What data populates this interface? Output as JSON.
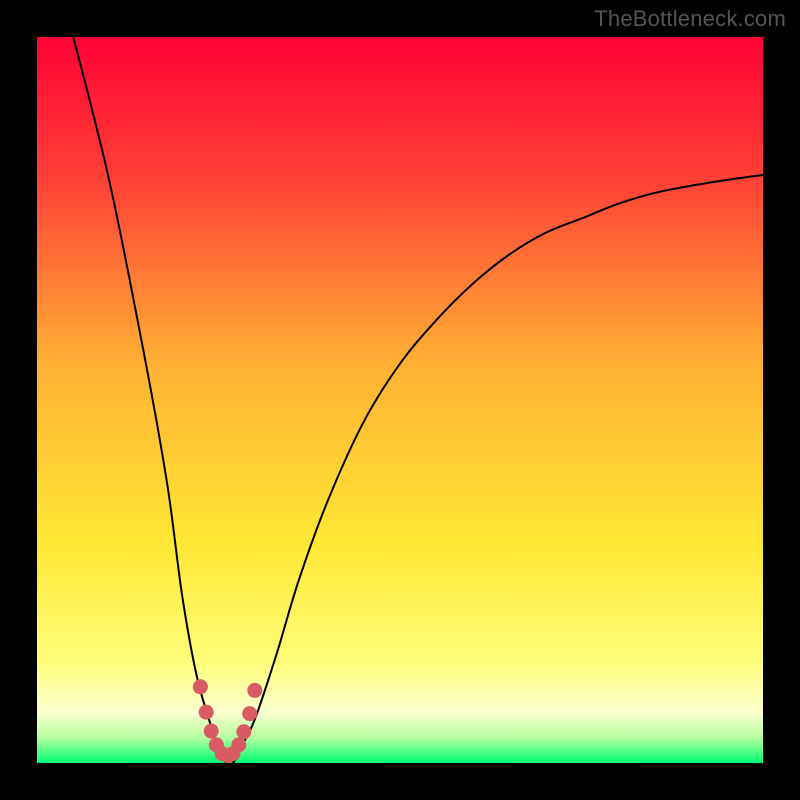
{
  "watermark": "TheBottleneck.com",
  "colors": {
    "frame": "#000000",
    "curve": "#000000",
    "highlight": "#d85a62",
    "watermark_text": "#555555",
    "gradient_stops": [
      {
        "offset": 0.0,
        "color": "#ff0135"
      },
      {
        "offset": 0.2,
        "color": "#ff4236"
      },
      {
        "offset": 0.45,
        "color": "#ffb033"
      },
      {
        "offset": 0.7,
        "color": "#ffe834"
      },
      {
        "offset": 0.86,
        "color": "#fffd7a"
      },
      {
        "offset": 0.93,
        "color": "#fbffce"
      },
      {
        "offset": 0.965,
        "color": "#b6ffa0"
      },
      {
        "offset": 1.0,
        "color": "#00ff73"
      }
    ]
  },
  "chart_data": {
    "type": "line",
    "title": "",
    "xlabel": "",
    "ylabel": "",
    "xlim": [
      0,
      100
    ],
    "ylim": [
      0,
      100
    ],
    "annotations": [],
    "series": [
      {
        "name": "bottleneck-curve",
        "x": [
          5,
          10,
          15,
          18,
          20,
          22,
          24,
          25,
          26,
          27,
          28,
          30,
          33,
          36,
          40,
          45,
          50,
          55,
          60,
          65,
          70,
          75,
          80,
          85,
          90,
          95,
          100
        ],
        "values": [
          100,
          80,
          55,
          38,
          23,
          12,
          5,
          2,
          0,
          0,
          2,
          6,
          15,
          25,
          36,
          47,
          55,
          61,
          66,
          70,
          73,
          75,
          77,
          78.5,
          79.5,
          80.3,
          81
        ]
      }
    ],
    "highlight": {
      "name": "optimal-range",
      "x": [
        22.5,
        23.3,
        24.0,
        24.7,
        25.5,
        26.3,
        27.0,
        27.8,
        28.5,
        29.3,
        30.0
      ],
      "values": [
        10.5,
        7.0,
        4.4,
        2.5,
        1.3,
        1.0,
        1.3,
        2.5,
        4.3,
        6.8,
        10.0
      ]
    }
  }
}
